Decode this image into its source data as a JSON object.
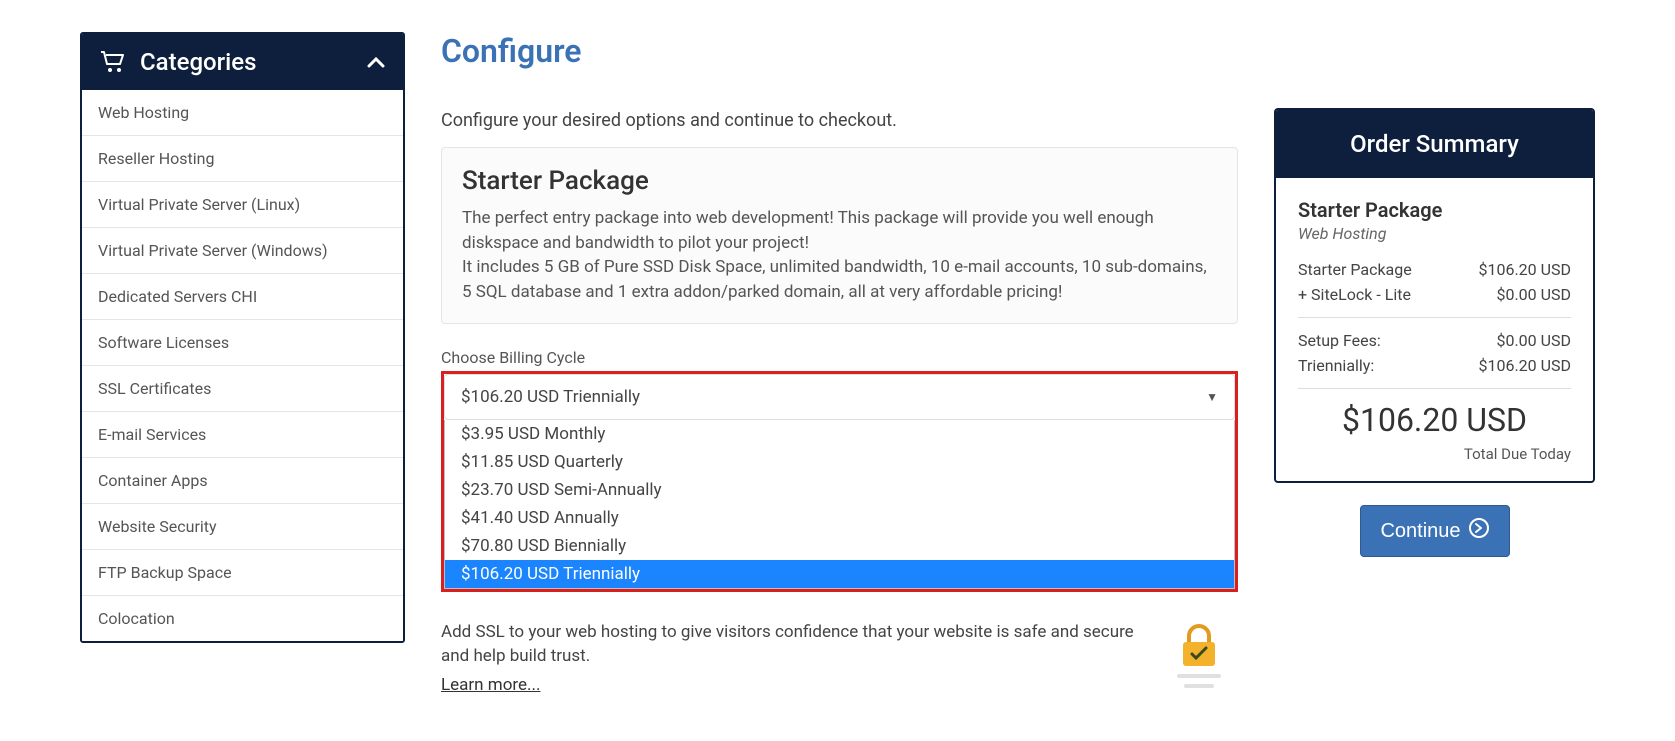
{
  "sidebar": {
    "title": "Categories",
    "items": [
      "Web Hosting",
      "Reseller Hosting",
      "Virtual Private Server (Linux)",
      "Virtual Private Server (Windows)",
      "Dedicated Servers CHI",
      "Software Licenses",
      "SSL Certificates",
      "E-mail Services",
      "Container Apps",
      "Website Security",
      "FTP Backup Space",
      "Colocation"
    ]
  },
  "main": {
    "title": "Configure",
    "subtitle": "Configure your desired options and continue to checkout.",
    "package": {
      "name": "Starter Package",
      "desc_line1": "The perfect entry package into web development! This package will provide you well enough diskspace and bandwidth to pilot your project!",
      "desc_line2": "It includes 5 GB of Pure SSD Disk Space, unlimited bandwidth, 10 e-mail accounts, 10 sub-domains, 5 SQL database and 1 extra addon/parked domain, all at very affordable pricing!"
    },
    "billing": {
      "label": "Choose Billing Cycle",
      "selected": "$106.20 USD Triennially",
      "options": [
        "$3.95 USD Monthly",
        "$11.85 USD Quarterly",
        "$23.70 USD Semi-Annually",
        "$41.40 USD Annually",
        "$70.80 USD Biennially",
        "$106.20 USD Triennially"
      ]
    },
    "addon": {
      "text": "Add SSL to your web hosting to give visitors confidence that your website is safe and secure and help build trust.",
      "learn_more": "Learn more..."
    }
  },
  "summary": {
    "header": "Order Summary",
    "product_title": "Starter Package",
    "product_category": "Web Hosting",
    "lines": [
      {
        "label": "Starter Package",
        "value": "$106.20 USD"
      },
      {
        "label": "+ SiteLock - Lite",
        "value": "$0.00 USD"
      }
    ],
    "fees": [
      {
        "label": "Setup Fees:",
        "value": "$0.00 USD"
      },
      {
        "label": "Triennially:",
        "value": "$106.20 USD"
      }
    ],
    "total": "$106.20 USD",
    "total_label": "Total Due Today",
    "continue": "Continue"
  }
}
